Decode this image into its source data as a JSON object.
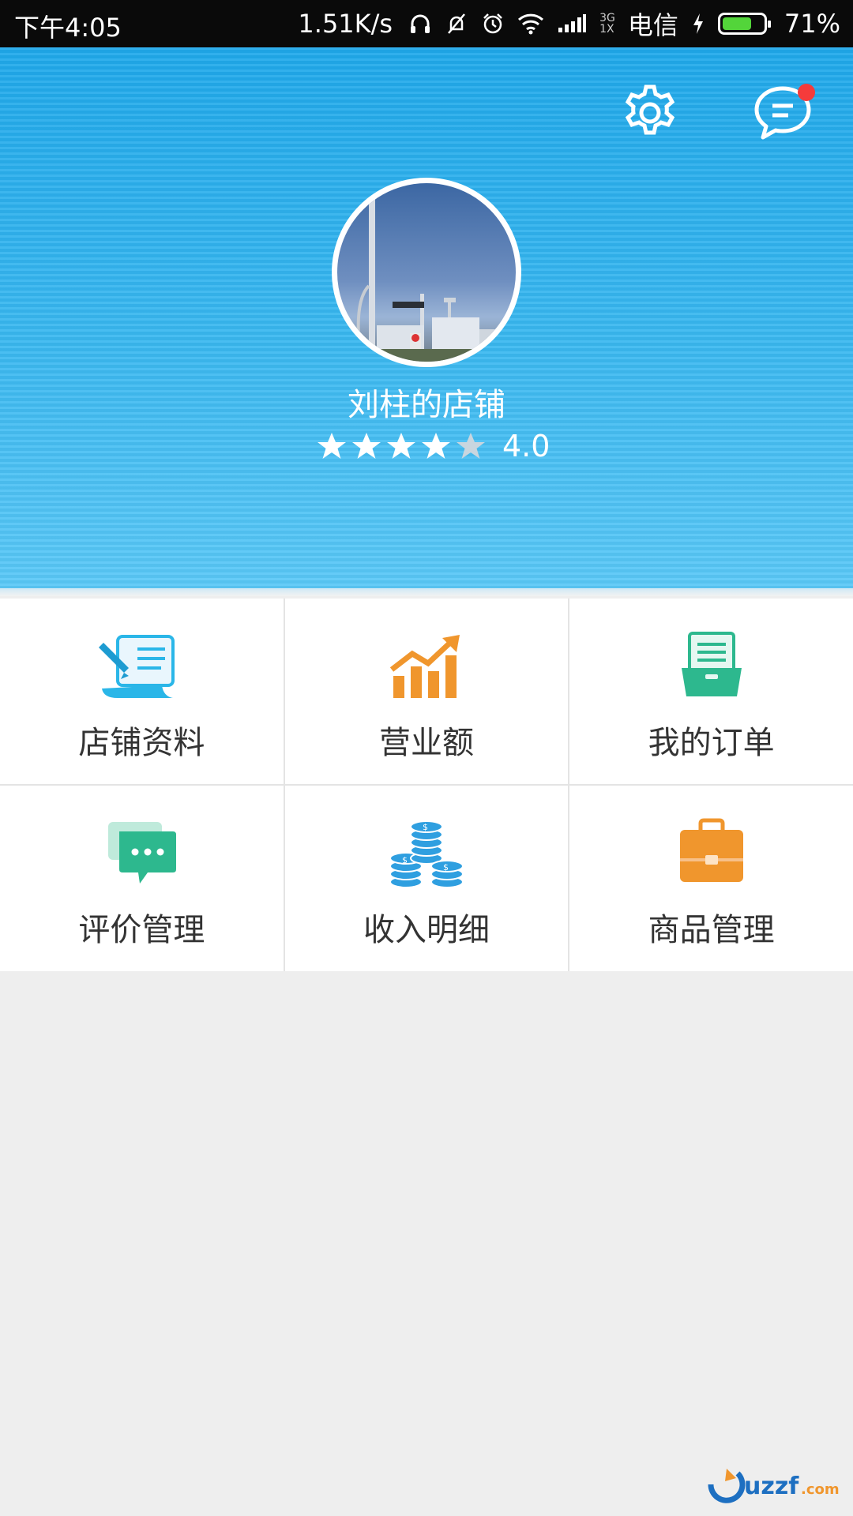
{
  "status_bar": {
    "time": "下午4:05",
    "speed": "1.51K/s",
    "network_label": "3G\n1X",
    "carrier": "电信",
    "battery_percent_label": "71%",
    "battery_level": 0.71,
    "icons": [
      "headphones-icon",
      "bell-muted-icon",
      "alarm-icon",
      "wifi-icon",
      "signal-icon",
      "charging-icon",
      "battery-icon"
    ]
  },
  "header": {
    "settings_icon": "gear-icon",
    "message_icon": "chat-bubble-icon",
    "has_notification": true,
    "shop_name": "刘柱的店铺",
    "rating_value": "4.0",
    "rating_stars": 4,
    "rating_max": 5,
    "colors": {
      "top": "#1fa8ea",
      "bottom": "#5ac8f7",
      "notification": "#f53b3b"
    }
  },
  "menu": [
    {
      "label": "店铺资料",
      "icon": "document-edit-icon",
      "color": "#2ab6e8"
    },
    {
      "label": "营业额",
      "icon": "chart-growth-icon",
      "color": "#f0962d"
    },
    {
      "label": "我的订单",
      "icon": "order-tray-icon",
      "color": "#2db88e"
    },
    {
      "label": "评价管理",
      "icon": "comment-icon",
      "color": "#2db88e"
    },
    {
      "label": "收入明细",
      "icon": "coins-icon",
      "color": "#2f9fe0"
    },
    {
      "label": "商品管理",
      "icon": "briefcase-icon",
      "color": "#f0962d"
    }
  ],
  "watermark": "uzzf.com"
}
